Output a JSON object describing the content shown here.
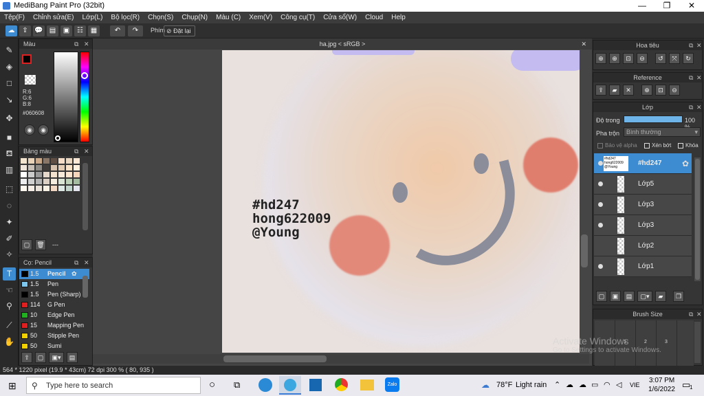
{
  "window": {
    "title": "MediBang Paint Pro (32bit)",
    "minimize": "—",
    "maximize": "❐",
    "close": "✕"
  },
  "menu": [
    "Tệp(F)",
    "Chỉnh sửa(E)",
    "Lớp(L)",
    "Bộ lọc(R)",
    "Chọn(S)",
    "Chụp(N)",
    "Màu (C)",
    "Xem(V)",
    "Công cụ(T)",
    "Cửa sổ(W)",
    "Cloud",
    "Help"
  ],
  "toolbar": {
    "phim_label": "Phím",
    "reset_label": "Đặt lại"
  },
  "document": {
    "tab_title": "ha.jpg < sRGB >"
  },
  "canvas_text": {
    "line1": "#hd247",
    "line2": "hong622009",
    "line3": "@Young"
  },
  "color_panel": {
    "title": "Màu",
    "r": "R:6",
    "g": "G:6",
    "b": "B:8",
    "hex": "#060608"
  },
  "palette_panel": {
    "title": "Bảng màu",
    "footer": "---"
  },
  "brush_panel": {
    "title": "Cọ: Pencil",
    "brushes": [
      {
        "size": "1.5",
        "name": "Pencil",
        "color": "#000000"
      },
      {
        "size": "1.5",
        "name": "Pen",
        "color": "#7ec8f0"
      },
      {
        "size": "1.5",
        "name": "Pen (Sharp)",
        "color": "#000000"
      },
      {
        "size": "114",
        "name": "G Pen",
        "color": "#e02020"
      },
      {
        "size": "10",
        "name": "Edge Pen",
        "color": "#20b020"
      },
      {
        "size": "15",
        "name": "Mapping Pen",
        "color": "#e02020"
      },
      {
        "size": "50",
        "name": "Stipple Pen",
        "color": "#f0d000"
      },
      {
        "size": "50",
        "name": "Sumi",
        "color": "#f0d000"
      }
    ]
  },
  "navigator_panel": {
    "title": "Hoa tiêu"
  },
  "reference_panel": {
    "title": "Reference"
  },
  "layer_panel": {
    "title": "Lớp",
    "opacity_label": "Độ trong",
    "opacity_value": "100 %",
    "opacity_fraction": 1.0,
    "blend_label": "Pha trộn",
    "blend_value": "Bình thường",
    "protect_alpha": "Bảo vệ alpha",
    "clipping": "Xén bớt",
    "lock": "Khóa",
    "layers": [
      "#hd247",
      "Lớp5",
      "Lớp3",
      "Lớp3",
      "Lớp2",
      "Lớp1"
    ]
  },
  "brushsize_panel": {
    "title": "Brush Size",
    "sizes": [
      "1",
      "2",
      "3"
    ]
  },
  "watermark": {
    "line1": "Activate Windows",
    "line2": "Go to Settings to activate Windows."
  },
  "status": {
    "text": "564 * 1220 pixel  (19.9 * 43cm)  72 dpi  300 %  ( 80, 935 )"
  },
  "taskbar": {
    "search_placeholder": "Type here to search",
    "weather_temp": "78°F",
    "weather_desc": "Light rain",
    "lang": "VIE",
    "time": "3:07 PM",
    "date": "1/6/2022",
    "notif_count": "1"
  },
  "colors": {
    "accent": "#3d8bd1",
    "panel": "#353535",
    "canvas_bg": "#454545"
  }
}
